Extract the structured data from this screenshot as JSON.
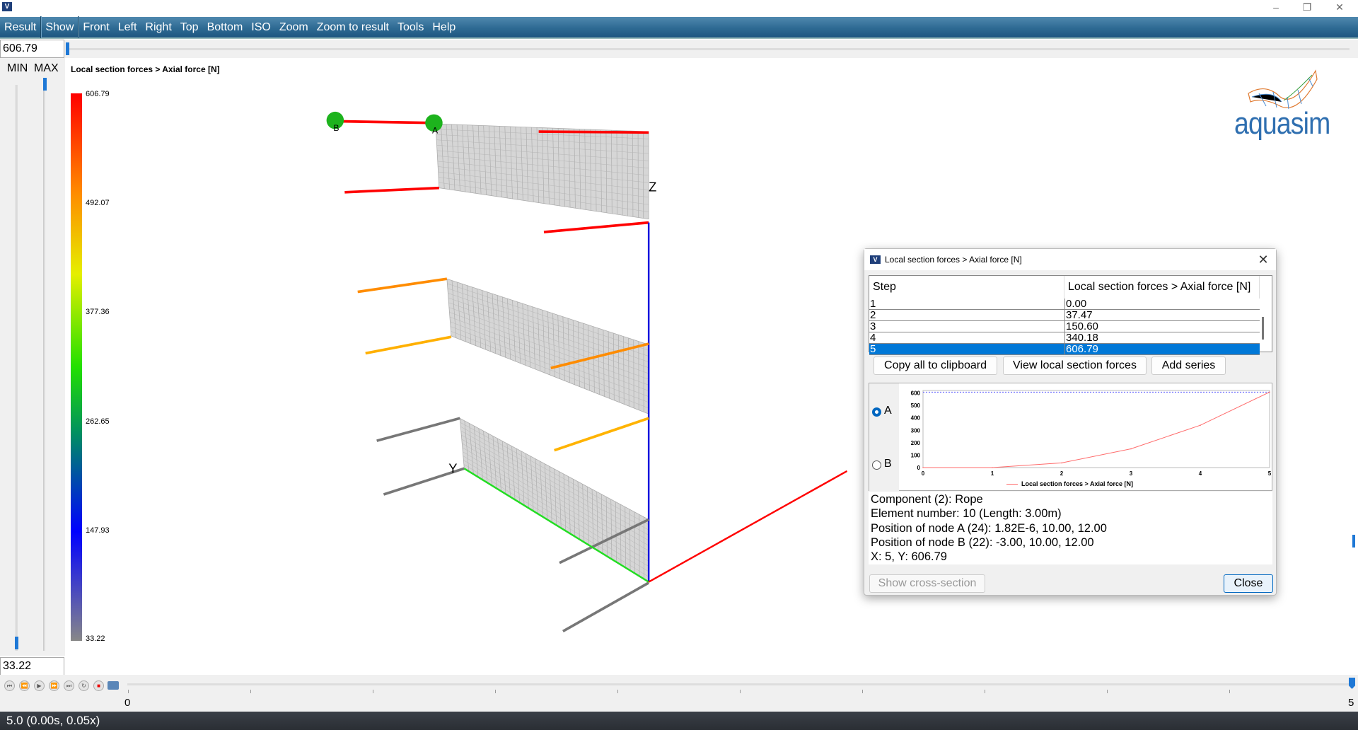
{
  "window": {
    "icon": "aquasim-app-icon",
    "controls": [
      "minimize",
      "restore",
      "close"
    ]
  },
  "menu": [
    "Result",
    "Show",
    "Front",
    "Left",
    "Right",
    "Top",
    "Bottom",
    "ISO",
    "Zoom",
    "Zoom to result",
    "Tools",
    "Help"
  ],
  "range": {
    "max_value": "606.79",
    "min_value": "33.22",
    "min_label": "MIN",
    "max_label": "MAX"
  },
  "plot_title": "Local section forces > Axial force [N]",
  "legend": {
    "labels": [
      "606.79",
      "492.07",
      "377.36",
      "262.65",
      "147.93",
      "33.22"
    ],
    "colors": [
      "#ff0000",
      "#ff8a00",
      "#e5ef00",
      "#22e000",
      "#0000ff",
      "#888888"
    ]
  },
  "scene": {
    "node_labels": [
      "B",
      "A"
    ],
    "axis_labels": [
      "Z",
      "Y"
    ]
  },
  "logo": {
    "text": "aquasim"
  },
  "timeline": {
    "start_label": "0",
    "end_label": "5",
    "position": 5,
    "controls": [
      "first",
      "previous",
      "play",
      "next",
      "last",
      "loop",
      "record",
      "camera"
    ]
  },
  "status": "5.0 (0.00s, 0.05x)",
  "dialog": {
    "title": "Local section forces > Axial force [N]",
    "table": {
      "headers": [
        "Step",
        "Local section forces > Axial force [N]"
      ],
      "rows": [
        [
          "1",
          "0.00"
        ],
        [
          "2",
          "37.47"
        ],
        [
          "3",
          "150.60"
        ],
        [
          "4",
          "340.18"
        ],
        [
          "5",
          "606.79"
        ]
      ],
      "selected_row": 5
    },
    "buttons": {
      "copy": "Copy all to clipboard",
      "view": "View local section forces",
      "add": "Add series",
      "cross_section": "Show cross-section",
      "close": "Close"
    },
    "radios": [
      {
        "label": "A",
        "checked": true
      },
      {
        "label": "B",
        "checked": false
      }
    ],
    "info": [
      "Component (2): Rope",
      "Element number: 10 (Length: 3.00m)",
      "Position of node A (24): 1.82E-6, 10.00, 12.00",
      "Position of node B (22): -3.00, 10.00, 12.00",
      "X: 5, Y: 606.79"
    ]
  },
  "chart_data": {
    "type": "line",
    "x": [
      0,
      1,
      2,
      3,
      4,
      5
    ],
    "series": [
      {
        "name": "Local section forces > Axial force [N]",
        "values": [
          0,
          0,
          37.47,
          150.6,
          340.18,
          606.79
        ],
        "color": "#ff6b6b"
      }
    ],
    "reference_line": {
      "y": 606.79,
      "color": "#5555ff",
      "style": "dotted"
    },
    "xticks": [
      "0",
      "1",
      "2",
      "3",
      "4",
      "5"
    ],
    "yticks": [
      "0",
      "100",
      "200",
      "300",
      "400",
      "500",
      "600"
    ],
    "xlim": [
      0,
      5
    ],
    "ylim": [
      0,
      620
    ],
    "legend": "bottom",
    "grid": false
  }
}
